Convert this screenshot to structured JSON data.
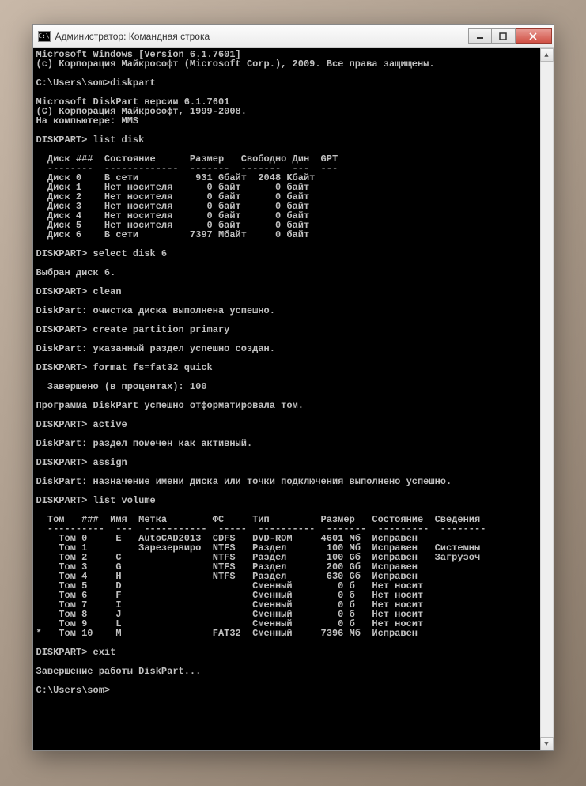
{
  "window": {
    "title": "Администратор: Командная строка",
    "icon_label": "C:\\"
  },
  "prompts": {
    "user": "C:\\Users\\som>",
    "diskpart": "DISKPART>"
  },
  "lines": [
    "Microsoft Windows [Version 6.1.7601]",
    "(c) Корпорация Майкрософт (Microsoft Corp.), 2009. Все права защищены.",
    "",
    "C:\\Users\\som>diskpart",
    "",
    "Microsoft DiskPart версии 6.1.7601",
    "(C) Корпорация Майкрософт, 1999-2008.",
    "На компьютере: MMS",
    "",
    "DISKPART> list disk",
    "",
    "  Диск ###  Состояние      Размер   Свободно Дин  GPT",
    "  --------  -------------  -------  -------  ---  ---",
    "  Диск 0    В сети          931 Gбайт  2048 Kбайт",
    "  Диск 1    Нет носителя      0 байт      0 байт",
    "  Диск 2    Нет носителя      0 байт      0 байт",
    "  Диск 3    Нет носителя      0 байт      0 байт",
    "  Диск 4    Нет носителя      0 байт      0 байт",
    "  Диск 5    Нет носителя      0 байт      0 байт",
    "  Диск 6    В сети         7397 Mбайт     0 байт",
    "",
    "DISKPART> select disk 6",
    "",
    "Выбран диск 6.",
    "",
    "DISKPART> clean",
    "",
    "DiskPart: очистка диска выполнена успешно.",
    "",
    "DISKPART> create partition primary",
    "",
    "DiskPart: указанный раздел успешно создан.",
    "",
    "DISKPART> format fs=fat32 quick",
    "",
    "  Завершено (в процентах): 100",
    "",
    "Программа DiskPart успешно отформатировала том.",
    "",
    "DISKPART> active",
    "",
    "DiskPart: раздел помечен как активный.",
    "",
    "DISKPART> assign",
    "",
    "DiskPart: назначение имени диска или точки подключения выполнено успешно.",
    "",
    "DISKPART> list volume",
    "",
    "  Том   ###  Имя  Метка        ФС     Тип         Размер   Состояние  Сведения",
    "  ----------  ---  -----------  -----  ----------  -------  ---------  --------",
    "    Том 0     E   AutoCAD2013  CDFS   DVD-ROM     4601 Mб  Исправен",
    "    Том 1         Зарезервиро  NTFS   Раздел       100 Mб  Исправен   Системны",
    "    Том 2     C                NTFS   Раздел       100 Gб  Исправен   Загрузоч",
    "    Том 3     G                NTFS   Раздел       200 Gб  Исправен",
    "    Том 4     H                NTFS   Раздел       630 Gб  Исправен",
    "    Том 5     D                       Сменный        0 б   Нет носит",
    "    Том 6     F                       Сменный        0 б   Нет носит",
    "    Том 7     I                       Сменный        0 б   Нет носит",
    "    Том 8     J                       Сменный        0 б   Нет носит",
    "    Том 9     L                       Сменный        0 б   Нет носит",
    "*   Том 10    M                FAT32  Сменный     7396 Mб  Исправен",
    "",
    "DISKPART> exit",
    "",
    "Завершение работы DiskPart...",
    "",
    "C:\\Users\\som>"
  ]
}
